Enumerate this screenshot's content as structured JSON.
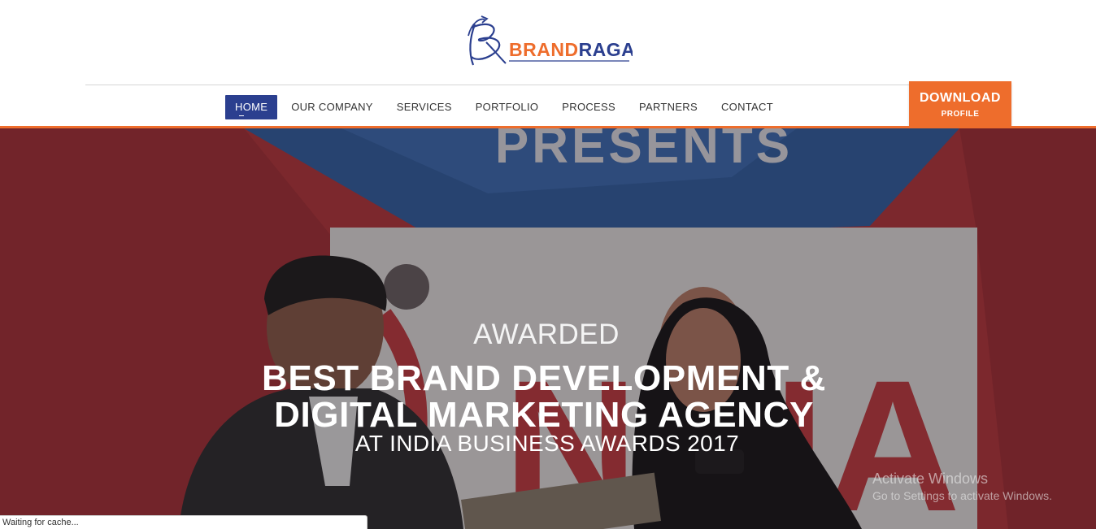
{
  "brand": {
    "name_part1": "BRAND",
    "name_part2": "RAGA",
    "colors": {
      "blue": "#2b3f8f",
      "orange": "#ee6d2c"
    },
    "logo_icon": "br-monogram-arrow-icon"
  },
  "nav": {
    "items": [
      {
        "label": "HOME",
        "active": true
      },
      {
        "label": "OUR COMPANY",
        "active": false
      },
      {
        "label": "SERVICES",
        "active": false
      },
      {
        "label": "PORTFOLIO",
        "active": false
      },
      {
        "label": "PROCESS",
        "active": false
      },
      {
        "label": "PARTNERS",
        "active": false
      },
      {
        "label": "CONTACT",
        "active": false
      }
    ]
  },
  "download": {
    "label": "DOWNLOAD",
    "sublabel": "PROFILE"
  },
  "hero": {
    "kicker": "AWARDED",
    "headline_line1": "BEST BRAND DEVELOPMENT &",
    "headline_line2": "DIGITAL MARKETING AGENCY",
    "subline": "AT INDIA BUSINESS AWARDS 2017",
    "backdrop_text_top": "PRESENTS",
    "backdrop_text_banner": "NDIA"
  },
  "os_watermark": {
    "title": "Activate Windows",
    "subtitle": "Go to Settings to activate Windows."
  },
  "status": {
    "text": "Waiting for cache..."
  }
}
